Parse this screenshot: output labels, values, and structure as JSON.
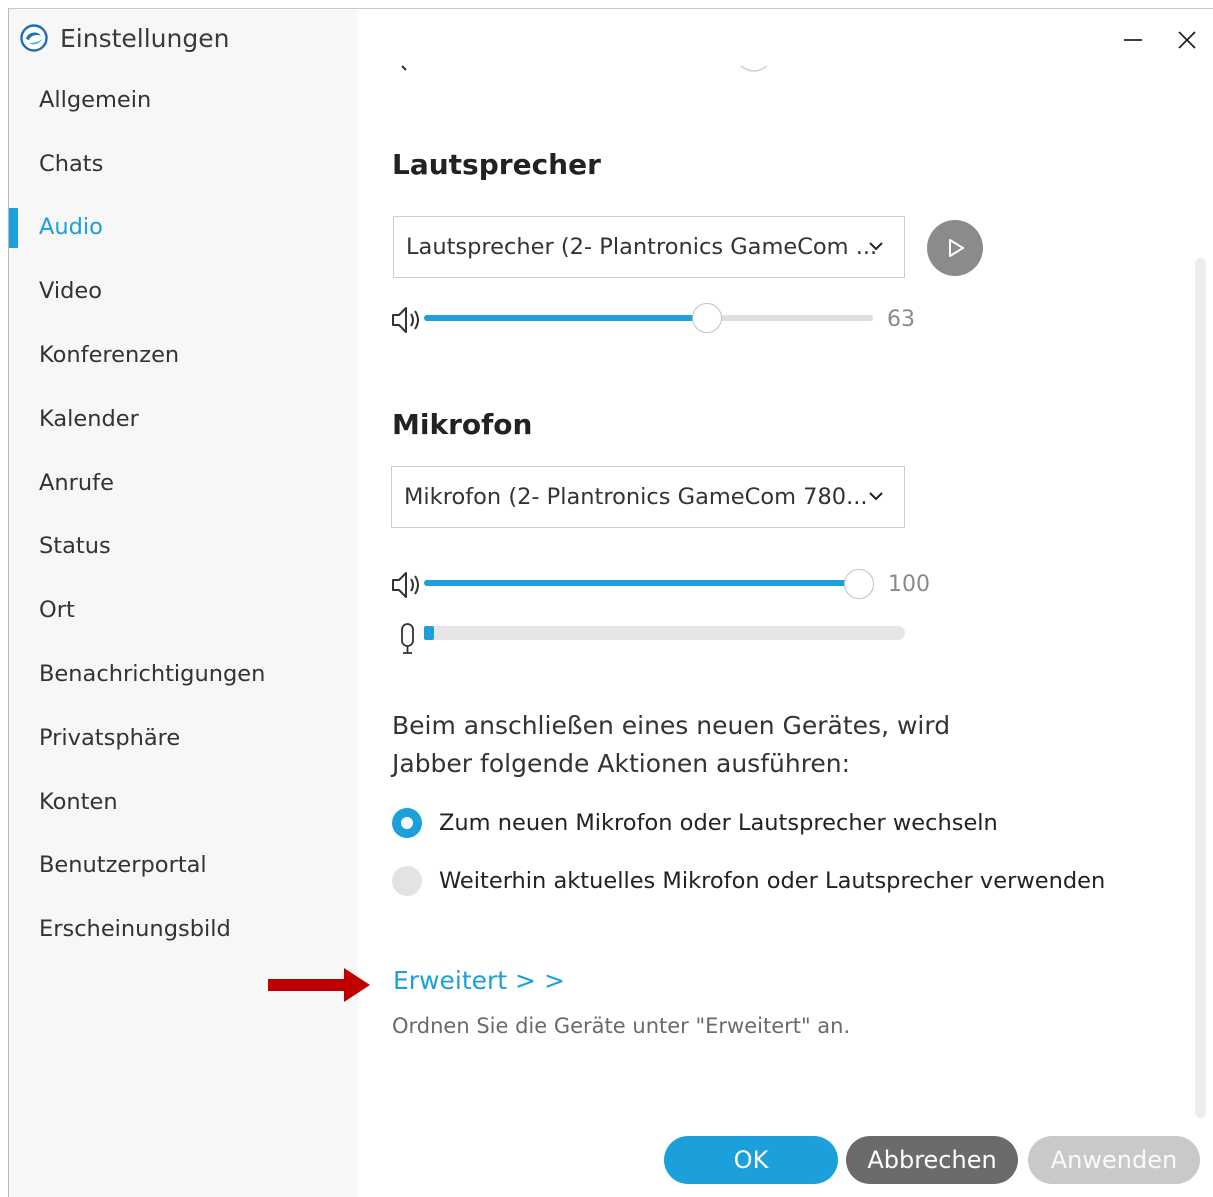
{
  "window": {
    "title": "Einstellungen"
  },
  "sidebar": {
    "items": [
      {
        "label": "Allgemein",
        "active": false
      },
      {
        "label": "Chats",
        "active": false
      },
      {
        "label": "Audio",
        "active": true
      },
      {
        "label": "Video",
        "active": false
      },
      {
        "label": "Konferenzen",
        "active": false
      },
      {
        "label": "Kalender",
        "active": false
      },
      {
        "label": "Anrufe",
        "active": false
      },
      {
        "label": "Status",
        "active": false
      },
      {
        "label": "Ort",
        "active": false
      },
      {
        "label": "Benachrichtigungen",
        "active": false
      },
      {
        "label": "Privatsphäre",
        "active": false
      },
      {
        "label": "Konten",
        "active": false
      },
      {
        "label": "Benutzerportal",
        "active": false
      },
      {
        "label": "Erscheinungsbild",
        "active": false
      }
    ]
  },
  "speaker": {
    "heading": "Lautsprecher",
    "device": "Lautsprecher (2- Plantronics GameCom ...",
    "volume": 63,
    "volume_label": "63"
  },
  "mic": {
    "heading": "Mikrofon",
    "device": "Mikrofon (2- Plantronics GameCom 780...",
    "volume": 100,
    "volume_label": "100",
    "input_level": 0.02
  },
  "new_device": {
    "description": "Beim anschließen eines neuen Gerätes, wird Jabber folgende Aktionen ausführen:",
    "options": [
      {
        "label": "Zum neuen Mikrofon oder Lautsprecher wechseln",
        "selected": true
      },
      {
        "label": "Weiterhin aktuelles Mikrofon oder Lautsprecher verwenden",
        "selected": false
      }
    ]
  },
  "advanced": {
    "link": "Erweitert > >",
    "hint": "Ordnen Sie die Geräte unter \"Erweitert\" an."
  },
  "buttons": {
    "ok": "OK",
    "cancel": "Abbrechen",
    "apply": "Anwenden"
  },
  "colors": {
    "accent": "#1ba0dc",
    "annotation_arrow": "#c00000"
  },
  "icons": {
    "app": "jabber-logo-icon",
    "minimize": "minimize-icon",
    "close": "close-icon",
    "play": "play-icon",
    "volume": "speaker-volume-icon",
    "mic": "microphone-icon",
    "dropdown": "chevron-down-icon"
  }
}
